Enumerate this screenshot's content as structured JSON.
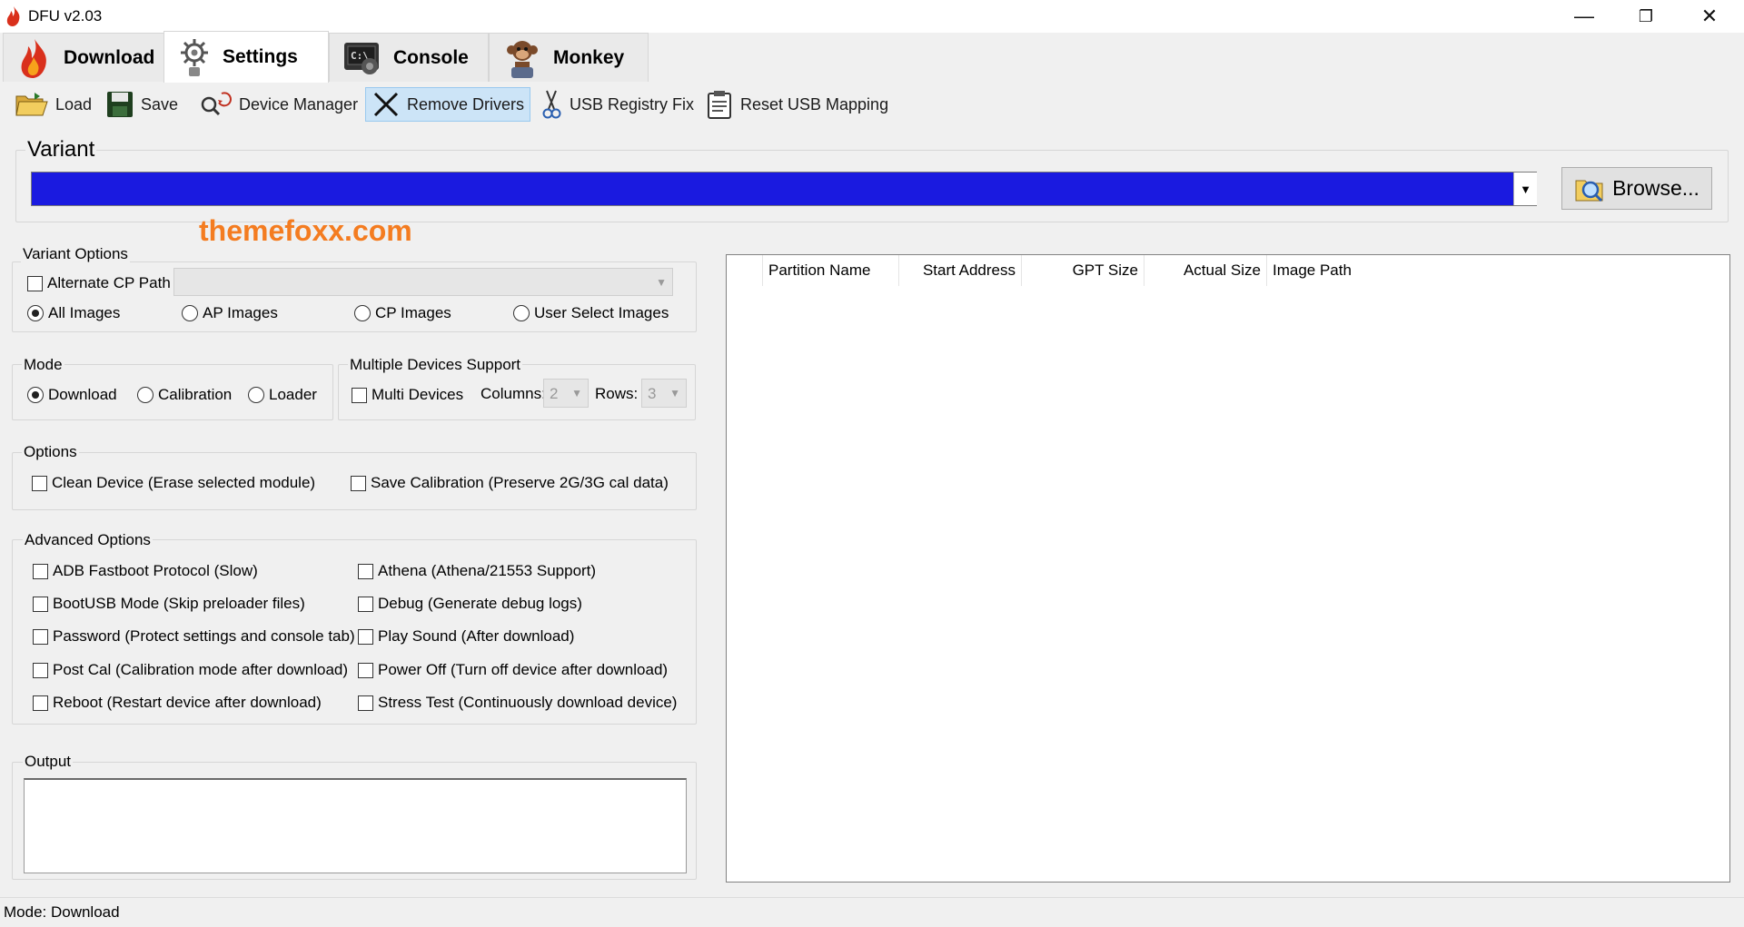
{
  "window": {
    "title": "DFU v2.03",
    "controls": {
      "minimize": "—",
      "restore": "❐",
      "close": "✕"
    }
  },
  "tabs": [
    {
      "label": "Download",
      "icon": "flame-icon"
    },
    {
      "label": "Settings",
      "icon": "gear-icon"
    },
    {
      "label": "Console",
      "icon": "console-icon"
    },
    {
      "label": "Monkey",
      "icon": "monkey-icon"
    }
  ],
  "active_tab": "Settings",
  "toolbar": {
    "load": "Load",
    "save": "Save",
    "device_manager": "Device Manager",
    "remove_drivers": "Remove Drivers",
    "usb_registry_fix": "USB Registry Fix",
    "reset_usb_mapping": "Reset USB Mapping"
  },
  "variant": {
    "label": "Variant",
    "value": "",
    "browse": "Browse..."
  },
  "watermark": "themefoxx.com",
  "variant_options": {
    "label": "Variant Options",
    "alternate_cp_path": {
      "label": "Alternate CP Path",
      "checked": false
    },
    "images": [
      {
        "label": "All Images",
        "selected": true
      },
      {
        "label": "AP Images",
        "selected": false
      },
      {
        "label": "CP Images",
        "selected": false
      },
      {
        "label": "User Select Images",
        "selected": false
      }
    ]
  },
  "mode": {
    "label": "Mode",
    "options": [
      {
        "label": "Download",
        "selected": true
      },
      {
        "label": "Calibration",
        "selected": false
      },
      {
        "label": "Loader",
        "selected": false
      }
    ]
  },
  "multi_devices": {
    "label": "Multiple Devices Support",
    "checkbox": {
      "label": "Multi Devices",
      "checked": false
    },
    "columns_label": "Columns:",
    "columns_value": "2",
    "rows_label": "Rows:",
    "rows_value": "3"
  },
  "options": {
    "label": "Options",
    "clean_device": {
      "label": "Clean Device (Erase selected module)",
      "checked": false
    },
    "save_calibration": {
      "label": "Save Calibration (Preserve 2G/3G cal data)",
      "checked": false
    }
  },
  "advanced_options": {
    "label": "Advanced Options",
    "left": [
      "ADB Fastboot Protocol (Slow)",
      "BootUSB Mode (Skip preloader files)",
      "Password (Protect settings and console tab)",
      "Post Cal (Calibration mode after download)",
      "Reboot (Restart device after download)"
    ],
    "right": [
      "Athena (Athena/21553 Support)",
      "Debug (Generate debug logs)",
      "Play Sound (After download)",
      "Power Off (Turn off device after download)",
      "Stress Test (Continuously download device)"
    ]
  },
  "output": {
    "label": "Output",
    "value": ""
  },
  "partition_table": {
    "columns": [
      "Partition Name",
      "Start Address",
      "GPT Size",
      "Actual Size",
      "Image Path"
    ],
    "rows": []
  },
  "status_bar": "Mode: Download",
  "colors": {
    "variant_bar": "#1a1ae0",
    "watermark": "#f47c20",
    "hover": "#cce4f7"
  }
}
